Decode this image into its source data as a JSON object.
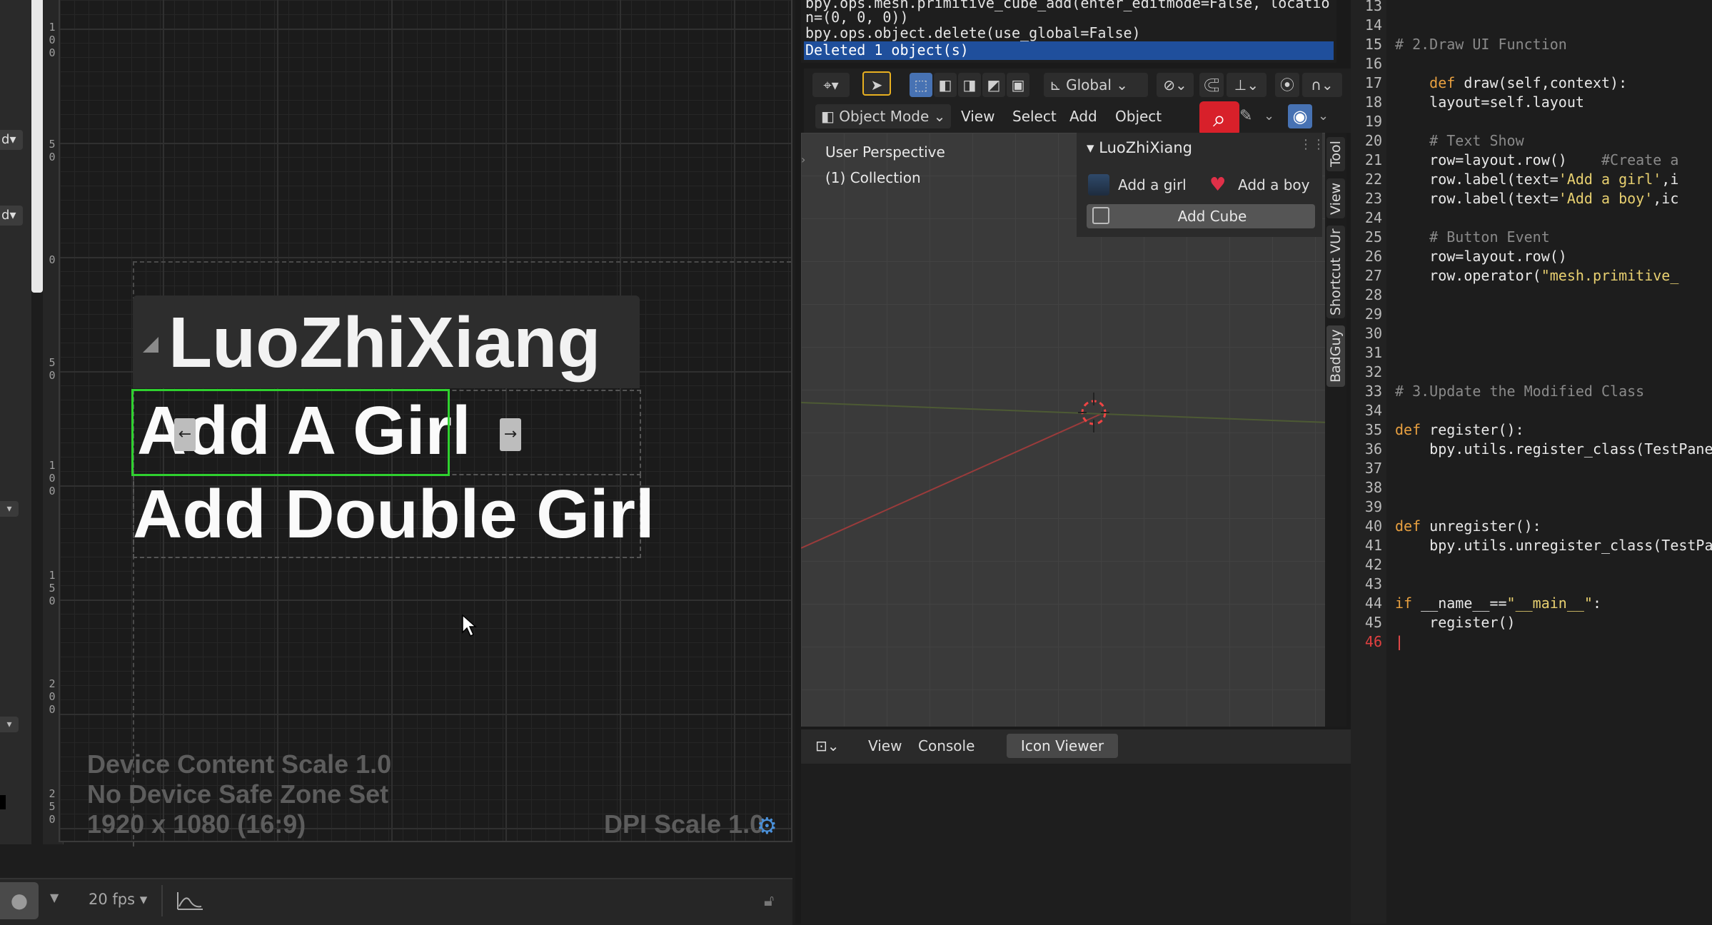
{
  "designer": {
    "ruler_labels": [
      "1",
      "0",
      "0",
      "5",
      "0",
      "0",
      "5",
      "0",
      "1",
      "0",
      "0",
      "1",
      "5",
      "0",
      "2",
      "0",
      "0",
      "2",
      "5",
      "0"
    ],
    "widget_title": "LuoZhiXiang",
    "button_girl": "Add A Girl",
    "button_double": "Add Double Girl",
    "overlay": {
      "scale": "Device Content Scale 1.0",
      "safe_zone": "No Device Safe Zone Set",
      "resolution": "1920 x 1080 (16:9)",
      "dpi": "DPI Scale 1.0"
    },
    "left_btn_glyph": "d",
    "handle_left": "←",
    "handle_right": "→"
  },
  "bottom_bar": {
    "fps": "20 fps"
  },
  "blender": {
    "log": {
      "line1": "bpy.ops.mesh.primitive_cube_add(enter_editmode=False, locatio",
      "line2": "n=(0, 0, 0))",
      "line3": "bpy.ops.object.delete(use_global=False)",
      "line4": "Deleted 1 object(s)"
    },
    "header": {
      "orientation": "Global",
      "mode": "Object Mode",
      "menu": [
        "View",
        "Select",
        "Add",
        "Object"
      ]
    },
    "viewport": {
      "perspective": "User Perspective",
      "collection": "(1) Collection"
    },
    "npanel": {
      "title": "LuoZhiXiang",
      "girl_label": "Add a girl",
      "boy_label": "Add a boy",
      "cube_button": "Add Cube"
    },
    "side_tabs": [
      "Tool",
      "View",
      "Shortcut VUr",
      "BadGuy"
    ],
    "console": {
      "view": "View",
      "console": "Console",
      "icon_viewer": "Icon Viewer"
    }
  },
  "code": {
    "line_numbers": [
      "13",
      "14",
      "15",
      "16",
      "17",
      "18",
      "19",
      "20",
      "21",
      "22",
      "23",
      "24",
      "25",
      "26",
      "27",
      "28",
      "29",
      "30",
      "31",
      "32",
      "33",
      "34",
      "35",
      "36",
      "37",
      "38",
      "39",
      "40",
      "41",
      "42",
      "43",
      "44",
      "45",
      "46"
    ],
    "lines": {
      "l15": "# 2.Draw UI Function",
      "l17_kw": "def",
      "l17_rest": " draw(self,context):",
      "l18": "    layout=self.layout",
      "l20": "    # Text Show",
      "l21_a": "    row=layout.row()",
      "l21_b": "    #Create a",
      "l22_a": "    row.label(text=",
      "l22_s": "'Add a girl'",
      "l22_b": ",i",
      "l23_a": "    row.label(text=",
      "l23_s": "'Add a boy'",
      "l23_b": ",ic",
      "l25": "    # Button Event",
      "l26": "    row=layout.row()",
      "l27_a": "    row.operator(",
      "l27_s": "\"mesh.primitive_",
      "l33": "# 3.Update the Modified Class",
      "l35_kw": "def",
      "l35_rest": " register():",
      "l36": "    bpy.utils.register_class(TestPane",
      "l40_kw": "def",
      "l40_rest": " unregister():",
      "l41": "    bpy.utils.unregister_class(TestPa",
      "l44_kw": "if",
      "l44_rest": " __name__==",
      "l44_s": "\"__main__\"",
      "l44_end": ":",
      "l45": "    register()",
      "l46": "|"
    }
  }
}
